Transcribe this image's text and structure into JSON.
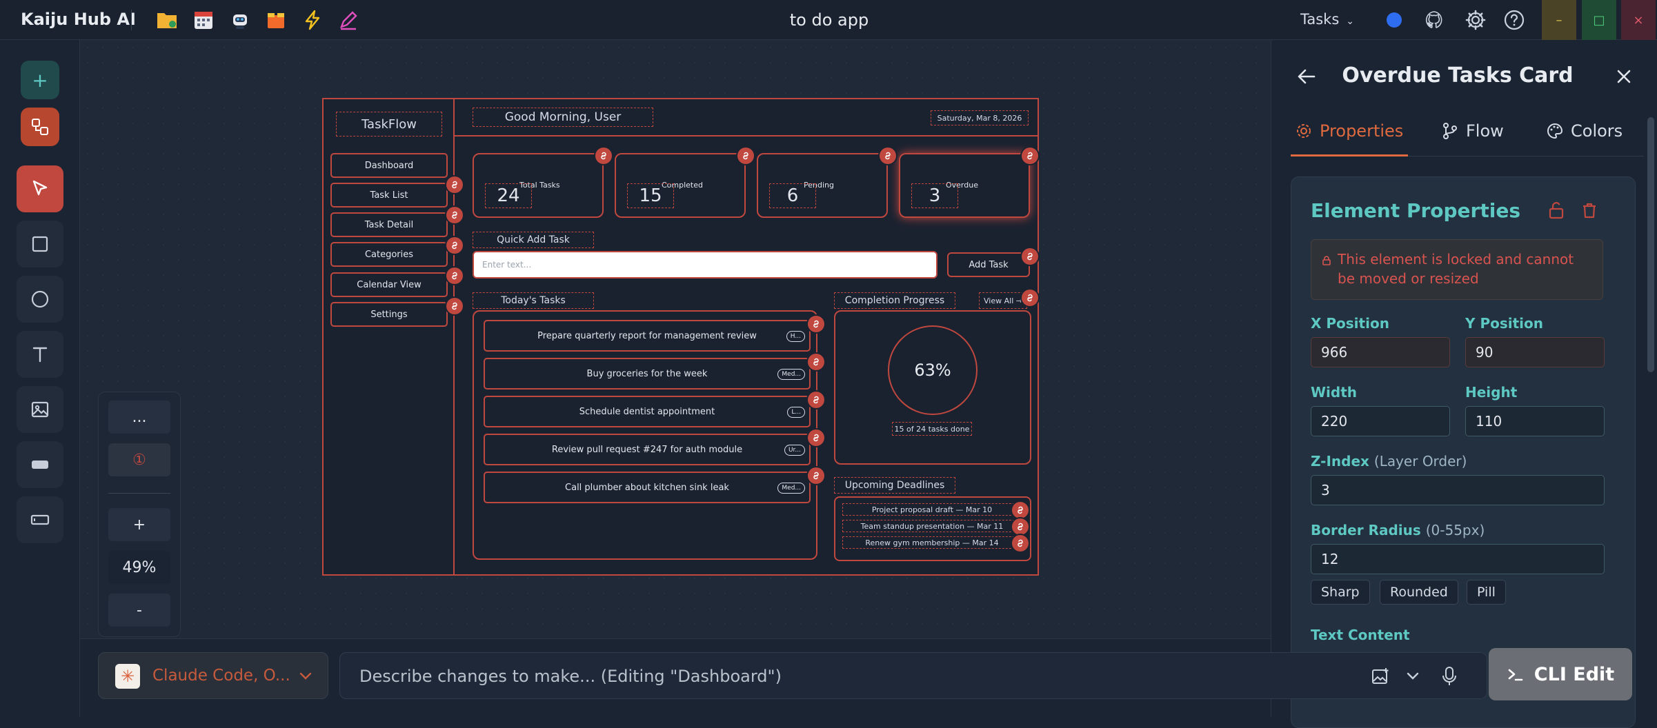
{
  "app": {
    "name": "Kaiju Hub AI",
    "window_title": "to do app"
  },
  "topbar": {
    "view_selector": "Tasks"
  },
  "zoom": {
    "more": "...",
    "alert": "①",
    "plus": "+",
    "level": "49%",
    "minus": "-"
  },
  "design": {
    "logo": "TaskFlow",
    "nav": [
      "Dashboard",
      "Task List",
      "Task Detail",
      "Categories",
      "Calendar View",
      "Settings"
    ],
    "greeting": "Good Morning, User",
    "date": "Saturday, Mar 8, 2026",
    "stats": [
      {
        "label": "Total Tasks",
        "value": "24"
      },
      {
        "label": "Completed",
        "value": "15"
      },
      {
        "label": "Pending",
        "value": "6"
      },
      {
        "label": "Overdue",
        "value": "3"
      }
    ],
    "quick_add_label": "Quick Add Task",
    "quick_add_placeholder": "Enter text...",
    "add_button": "Add Task",
    "todays_tasks_label": "Today's Tasks",
    "tasks": [
      {
        "title": "Prepare quarterly report for management review",
        "priority": "H..."
      },
      {
        "title": "Buy groceries for the week",
        "priority": "Med..."
      },
      {
        "title": "Schedule dentist appointment",
        "priority": "L..."
      },
      {
        "title": "Review pull request #247 for auth module",
        "priority": "Ur..."
      },
      {
        "title": "Call plumber about kitchen sink leak",
        "priority": "Med..."
      }
    ],
    "completion_label": "Completion Progress",
    "view_all": "View All →",
    "progress_percent": "63%",
    "progress_note": "15 of 24 tasks done",
    "deadlines_label": "Upcoming Deadlines",
    "deadlines": [
      "Project proposal draft — Mar 10",
      "Team standup presentation — Mar 11",
      "Renew gym membership — Mar 14"
    ]
  },
  "panel": {
    "title": "Overdue Tasks Card",
    "tabs": [
      "Properties",
      "Flow",
      "Colors"
    ],
    "section_title": "Element Properties",
    "lock_message": "This element is locked and cannot be moved or resized",
    "x_label": "X Position",
    "x_value": "966",
    "y_label": "Y Position",
    "y_value": "90",
    "width_label": "Width",
    "width_value": "220",
    "height_label": "Height",
    "height_value": "110",
    "z_label": "Z-Index",
    "z_sub": "(Layer Order)",
    "z_value": "3",
    "radius_label": "Border Radius",
    "radius_sub": "(0-55px)",
    "radius_value": "12",
    "radius_presets": [
      "Sharp",
      "Rounded",
      "Pill"
    ],
    "text_content_label": "Text Content"
  },
  "bottom": {
    "model": "Claude Code, O...",
    "prompt_placeholder": "Describe changes to make... (Editing \"Dashboard\")",
    "cli_button": "CLI Edit"
  },
  "colors": {
    "accent": "#c0483f",
    "teal": "#5ec8c3",
    "bg": "#1b2433"
  }
}
